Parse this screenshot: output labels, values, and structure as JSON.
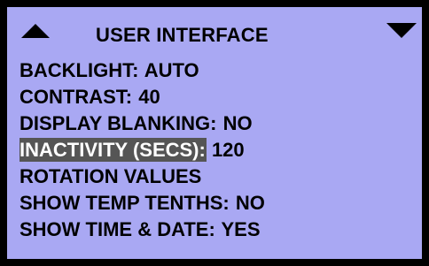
{
  "header": {
    "title": "USER INTERFACE"
  },
  "menu": {
    "items": [
      {
        "label": "BACKLIGHT:",
        "value": " AUTO"
      },
      {
        "label": "CONTRAST:",
        "value": " 40"
      },
      {
        "label": "DISPLAY BLANKING:",
        "value": " NO"
      },
      {
        "label": "INACTIVITY (SECS):",
        "value": " 120",
        "selected": true
      },
      {
        "label": "ROTATION VALUES",
        "value": ""
      },
      {
        "label": "SHOW TEMP TENTHS:",
        "value": " NO"
      },
      {
        "label": "SHOW TIME & DATE:",
        "value": " YES"
      }
    ]
  },
  "colors": {
    "screen_background": "#a9a8f3",
    "bezel": "#000000",
    "selection_background": "#555555",
    "selection_text": "#ffffff"
  },
  "icons": {
    "scroll_up": "triangle-up",
    "scroll_down": "triangle-down"
  }
}
